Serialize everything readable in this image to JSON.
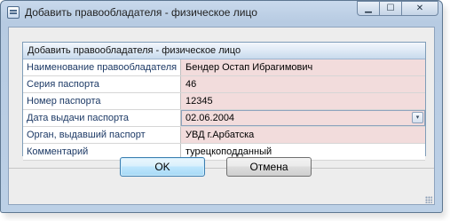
{
  "window": {
    "title": "Добавить правообладателя - физическое лицо",
    "caption_buttons": {
      "minimize": "▁",
      "maximize": "☐",
      "close": "✕"
    }
  },
  "form": {
    "header": "Добавить правообладателя - физическое лицо",
    "fields": [
      {
        "label": "Наименование правообладателя",
        "value": "Бендер Остап Ибрагимович",
        "required": true
      },
      {
        "label": "Серия паспорта",
        "value": "46",
        "required": true
      },
      {
        "label": "Номер паспорта",
        "value": "12345",
        "required": true
      },
      {
        "label": "Дата выдачи паспорта",
        "value": "02.06.2004",
        "required": true,
        "has_dropdown": true
      },
      {
        "label": "Орган, выдавший паспорт",
        "value": "УВД  г.Арбатска",
        "required": true
      },
      {
        "label": "Комментарий",
        "value": "турецкоподданный",
        "required": false
      }
    ],
    "dropdown_icon": "▾"
  },
  "buttons": {
    "ok": "OK",
    "cancel": "Отмена"
  },
  "colors": {
    "required_bg": "#f2dcdc",
    "label_text": "#1d3a66",
    "ok_border": "#3c7fb1"
  }
}
